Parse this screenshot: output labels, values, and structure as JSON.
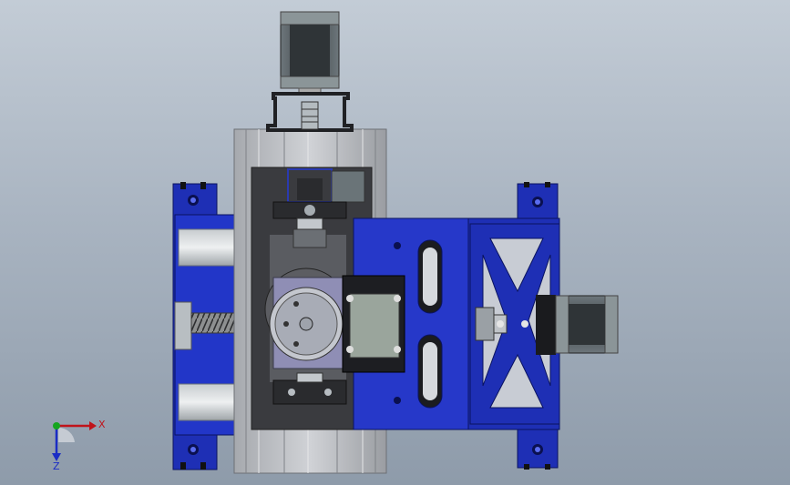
{
  "viewport": {
    "background_top": "#c3ccd6",
    "background_bottom": "#8e9baa"
  },
  "colors": {
    "blue_part": "#1e2fb5",
    "blue_dark": "#0d1a7a",
    "aluminum": "#b9bcc1",
    "aluminum_dark": "#8a8d92",
    "steel": "#9fa6ab",
    "dark_plate": "#3a3b3f",
    "motor_body": "#4d5458",
    "motor_cap": "#8b9598",
    "flange_grey": "#8f8eb5",
    "block_grey": "#9aa59c"
  },
  "model": {
    "name": "cnc-linear-stage-assembly",
    "parts": [
      {
        "name": "top-stepper-motor-icon"
      },
      {
        "name": "motor-mount-bracket-icon"
      },
      {
        "name": "shaft-coupler-icon"
      },
      {
        "name": "aluminum-extrusion-frame-icon"
      },
      {
        "name": "left-blue-carriage-icon"
      },
      {
        "name": "right-blue-carriage-icon"
      },
      {
        "name": "lead-screw-icon"
      },
      {
        "name": "rotary-flange-icon"
      },
      {
        "name": "right-stepper-motor-icon"
      }
    ]
  },
  "triad": {
    "x_label": "X",
    "z_label": "Z",
    "x_color": "#c0141b",
    "z_color": "#1a2cc5",
    "y_color": "#14a51e"
  }
}
